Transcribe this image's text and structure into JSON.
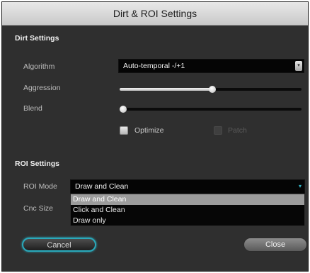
{
  "window": {
    "title": "Dirt & ROI Settings"
  },
  "dirt": {
    "heading": "Dirt Settings",
    "algorithm_label": "Algorithm",
    "algorithm_value": "Auto-temporal -/+1",
    "aggression_label": "Aggression",
    "aggression_level": 0.51,
    "blend_label": "Blend",
    "blend_level": 0.02,
    "optimize_label": "Optimize",
    "patch_label": "Patch"
  },
  "roi": {
    "heading": "ROI Settings",
    "mode_label": "ROI Mode",
    "mode_value": "Draw and Clean",
    "size_label": "Cnc Size",
    "mode_options": [
      "Draw and Clean",
      "Click and Clean",
      "Draw only"
    ]
  },
  "buttons": {
    "cancel": "Cancel",
    "close": "Close"
  },
  "colors": {
    "accent": "#2aa9bb",
    "panel": "#2f2f2f",
    "selection": "#9c9c9c"
  }
}
